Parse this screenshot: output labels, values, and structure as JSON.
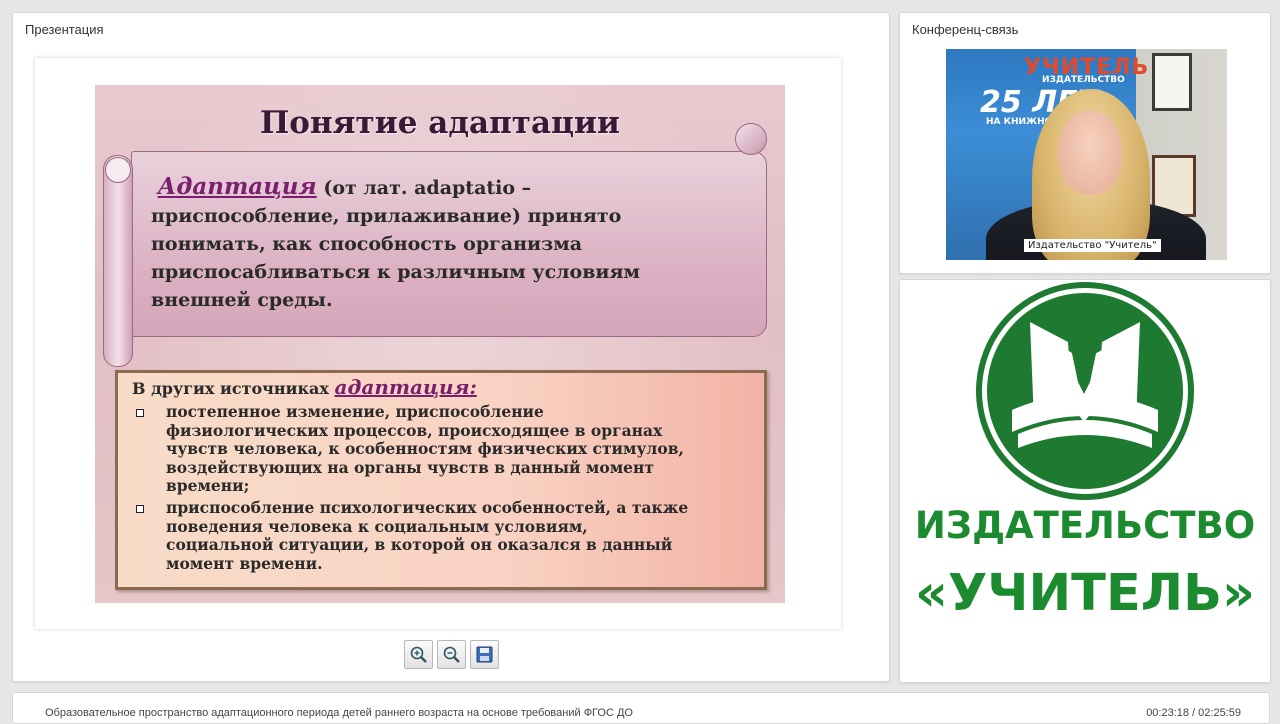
{
  "presentation": {
    "title": "Презентация"
  },
  "slide": {
    "title": "Понятие адаптации",
    "definition_term": "Адаптация",
    "definition_lines": [
      "(от лат. adaptatio –",
      "приспособление, прилаживание) принято",
      "понимать, как  способность организма",
      "приспосабливаться к различным условиям",
      "внешней среды."
    ],
    "sources_prefix": "В других источниках",
    "sources_term": "адаптация:",
    "bullets": [
      [
        "постепенное изменение, приспособление",
        "физиологических процессов, происходящее в органах",
        "чувств человека, к особенностям физических стимулов,",
        "воздействующих на органы чувств в данный момент",
        "времени;"
      ],
      [
        "приспособление психологических особенностей, а также",
        "поведения человека к социальным условиям,",
        "социальной ситуации, в которой он оказался в данный",
        "момент времени."
      ]
    ]
  },
  "toolbar": {
    "zoom_in": "zoom-in-icon",
    "zoom_out": "zoom-out-icon",
    "save": "save-icon"
  },
  "conference": {
    "title": "Конференц-связь",
    "participant_label": "Издательство \"Учитель\"",
    "poster_brand": "УЧИТЕЛЬ",
    "poster_sub1": "ИЗДАТЕЛЬСТВО",
    "poster_big": "25 ЛЕТ",
    "poster_sub2": "НА КНИЖНОМ"
  },
  "logo": {
    "line1": "ИЗДАТЕЛЬСТВО",
    "line2": "«УЧИТЕЛЬ»",
    "color": "#1c8a2f"
  },
  "status": {
    "webinar_title": "Образовательное пространство адаптационного периода детей раннего возраста на основе требований ФГОС ДО",
    "time": "00:23:18 / 02:25:59"
  }
}
